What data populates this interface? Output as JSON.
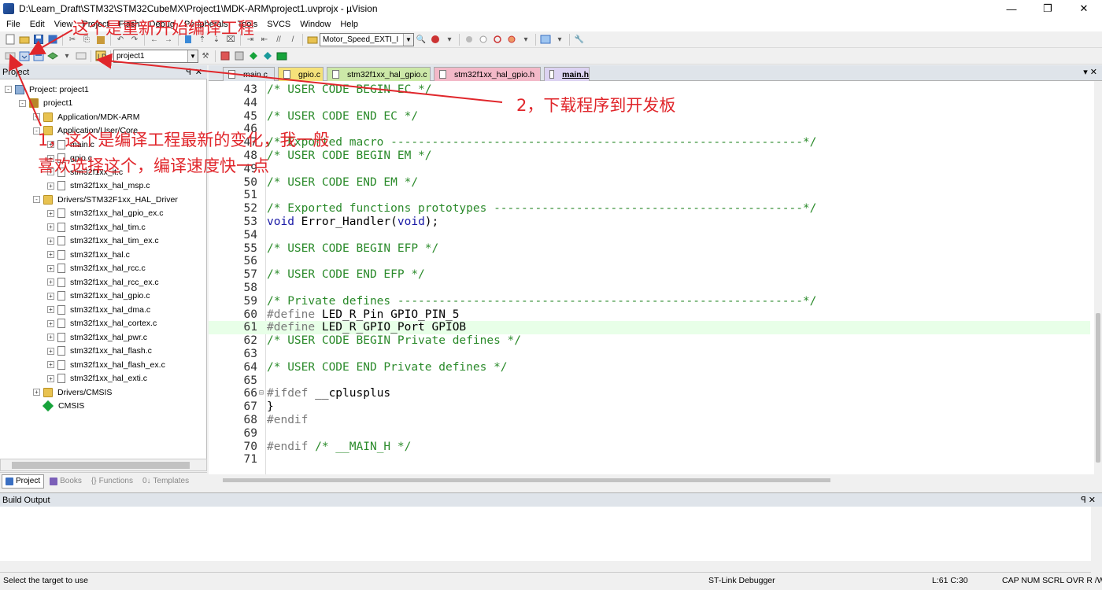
{
  "window": {
    "title": "D:\\Learn_Draft\\STM32\\STM32CubeMX\\Project1\\MDK-ARM\\project1.uvprojx - µVision",
    "minimize": "—",
    "maximize": "❐",
    "close": "✕"
  },
  "menu": [
    "File",
    "Edit",
    "View",
    "Project",
    "Flash",
    "Debug",
    "Peripherals",
    "Tools",
    "SVCS",
    "Window",
    "Help"
  ],
  "toolbar1": {
    "find_combo": "Motor_Speed_EXTI_I"
  },
  "toolbar2": {
    "target_combo": "project1"
  },
  "project_panel": {
    "title": "Project",
    "tree": [
      {
        "label": "Project: project1",
        "level": 0,
        "toggle": "-",
        "icon": "project-icon"
      },
      {
        "label": "project1",
        "level": 1,
        "toggle": "-",
        "icon": "target-icon"
      },
      {
        "label": "Application/MDK-ARM",
        "level": 2,
        "toggle": "+",
        "icon": "folder-icon"
      },
      {
        "label": "Application/User/Core",
        "level": 2,
        "toggle": "-",
        "icon": "folder-icon"
      },
      {
        "label": "main.c",
        "level": 3,
        "toggle": "+",
        "icon": "file-icon"
      },
      {
        "label": "gpio.c",
        "level": 3,
        "toggle": "+",
        "icon": "file-icon"
      },
      {
        "label": "stm32f1xx_it.c",
        "level": 3,
        "toggle": "+",
        "icon": "file-icon"
      },
      {
        "label": "stm32f1xx_hal_msp.c",
        "level": 3,
        "toggle": "+",
        "icon": "file-icon"
      },
      {
        "label": "Drivers/STM32F1xx_HAL_Driver",
        "level": 2,
        "toggle": "-",
        "icon": "folder-icon"
      },
      {
        "label": "stm32f1xx_hal_gpio_ex.c",
        "level": 3,
        "toggle": "+",
        "icon": "file-icon"
      },
      {
        "label": "stm32f1xx_hal_tim.c",
        "level": 3,
        "toggle": "+",
        "icon": "file-icon"
      },
      {
        "label": "stm32f1xx_hal_tim_ex.c",
        "level": 3,
        "toggle": "+",
        "icon": "file-icon"
      },
      {
        "label": "stm32f1xx_hal.c",
        "level": 3,
        "toggle": "+",
        "icon": "file-icon"
      },
      {
        "label": "stm32f1xx_hal_rcc.c",
        "level": 3,
        "toggle": "+",
        "icon": "file-icon"
      },
      {
        "label": "stm32f1xx_hal_rcc_ex.c",
        "level": 3,
        "toggle": "+",
        "icon": "file-icon"
      },
      {
        "label": "stm32f1xx_hal_gpio.c",
        "level": 3,
        "toggle": "+",
        "icon": "file-icon"
      },
      {
        "label": "stm32f1xx_hal_dma.c",
        "level": 3,
        "toggle": "+",
        "icon": "file-icon"
      },
      {
        "label": "stm32f1xx_hal_cortex.c",
        "level": 3,
        "toggle": "+",
        "icon": "file-icon"
      },
      {
        "label": "stm32f1xx_hal_pwr.c",
        "level": 3,
        "toggle": "+",
        "icon": "file-icon"
      },
      {
        "label": "stm32f1xx_hal_flash.c",
        "level": 3,
        "toggle": "+",
        "icon": "file-icon"
      },
      {
        "label": "stm32f1xx_hal_flash_ex.c",
        "level": 3,
        "toggle": "+",
        "icon": "file-icon"
      },
      {
        "label": "stm32f1xx_hal_exti.c",
        "level": 3,
        "toggle": "+",
        "icon": "file-icon"
      },
      {
        "label": "Drivers/CMSIS",
        "level": 2,
        "toggle": "+",
        "icon": "folder-icon"
      },
      {
        "label": "CMSIS",
        "level": 2,
        "toggle": "",
        "icon": "cmsis-icon"
      }
    ],
    "tabs": [
      "Project",
      "Books",
      "Functions",
      "Templates"
    ]
  },
  "editor_tabs": [
    {
      "label": "main.c",
      "color": "#dfe4ea",
      "active": false
    },
    {
      "label": "gpio.c",
      "color": "#f5e27a",
      "active": false
    },
    {
      "label": "stm32f1xx_hal_gpio.c",
      "color": "#cce8a8",
      "active": false
    },
    {
      "label": "stm32f1xx_hal_gpio.h",
      "color": "#f3b9c8",
      "active": false
    },
    {
      "label": "main.h",
      "color": "#dcd3f2",
      "active": true
    }
  ],
  "code_lines": [
    {
      "n": "43",
      "text": "/* USER CODE BEGIN EC */",
      "type": "cm"
    },
    {
      "n": "44",
      "text": "",
      "type": ""
    },
    {
      "n": "45",
      "text": "/* USER CODE END EC */",
      "type": "cm"
    },
    {
      "n": "46",
      "text": "",
      "type": ""
    },
    {
      "n": "47",
      "text": "/* Exported macro ------------------------------------------------------------*/",
      "type": "cm"
    },
    {
      "n": "48",
      "text": "/* USER CODE BEGIN EM */",
      "type": "cm"
    },
    {
      "n": "49",
      "text": "",
      "type": ""
    },
    {
      "n": "50",
      "text": "/* USER CODE END EM */",
      "type": "cm"
    },
    {
      "n": "51",
      "text": "",
      "type": ""
    },
    {
      "n": "52",
      "text": "/* Exported functions prototypes ---------------------------------------------*/",
      "type": "cm"
    },
    {
      "n": "53",
      "text": "void Error_Handler(void);",
      "type": "fn"
    },
    {
      "n": "54",
      "text": "",
      "type": ""
    },
    {
      "n": "55",
      "text": "/* USER CODE BEGIN EFP */",
      "type": "cm"
    },
    {
      "n": "56",
      "text": "",
      "type": ""
    },
    {
      "n": "57",
      "text": "/* USER CODE END EFP */",
      "type": "cm"
    },
    {
      "n": "58",
      "text": "",
      "type": ""
    },
    {
      "n": "59",
      "text": "/* Private defines -----------------------------------------------------------*/",
      "type": "cm"
    },
    {
      "n": "60",
      "text": "#define LED_R_Pin GPIO_PIN_5",
      "type": "def"
    },
    {
      "n": "61",
      "text": "#define LED_R_GPIO_Port GPIOB",
      "type": "def",
      "highlight": true
    },
    {
      "n": "62",
      "text": "/* USER CODE BEGIN Private defines */",
      "type": "cm"
    },
    {
      "n": "63",
      "text": "",
      "type": ""
    },
    {
      "n": "64",
      "text": "/* USER CODE END Private defines */",
      "type": "cm"
    },
    {
      "n": "65",
      "text": "",
      "type": ""
    },
    {
      "n": "66",
      "text": "#ifdef __cplusplus",
      "type": "def",
      "fold": "⊟"
    },
    {
      "n": "67",
      "text": "}",
      "type": ""
    },
    {
      "n": "68",
      "text": "#endif",
      "type": "pp"
    },
    {
      "n": "69",
      "text": "",
      "type": ""
    },
    {
      "n": "70",
      "text": "#endif /* __MAIN_H */",
      "type": "pp"
    },
    {
      "n": "71",
      "text": "",
      "type": ""
    }
  ],
  "build_output": {
    "title": "Build Output",
    "controls": "ꟼ ✕"
  },
  "status": {
    "hint": "Select the target to use",
    "debugger": "ST-Link Debugger",
    "position": "L:61 C:30",
    "flags": "CAP  NUM  SCRL  OVR  R /W"
  },
  "annotations": {
    "rebuild": "这个是重新开始编译工程",
    "download": "2，下载程序到开发板",
    "build_line1": "1，这个是编译工程最新的变化，我一般",
    "build_line2": "喜欢选择这个，编译速度快一点",
    "color": "#e0262b"
  }
}
